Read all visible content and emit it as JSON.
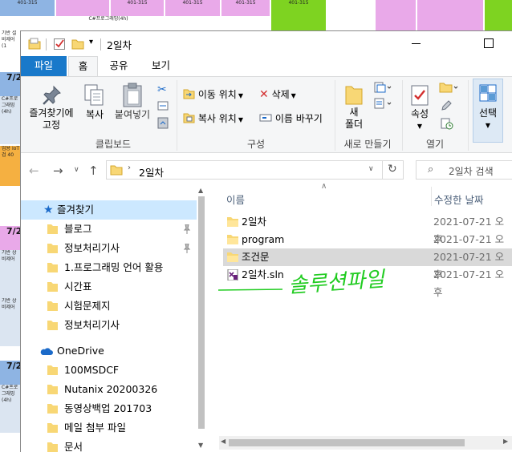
{
  "background": {
    "cells": [
      "401-315",
      "401-315",
      "401-315",
      "C#프로그래밍(4h)",
      "C#프로그래밍(4h)",
      "C#프로그래밍(4h)",
      "7/2",
      "7/2",
      "7/2",
      "7/2",
      "401-315",
      "401-315"
    ]
  },
  "window": {
    "title": "2일차",
    "tabs": {
      "file": "파일",
      "home": "홈",
      "share": "공유",
      "view": "보기"
    }
  },
  "ribbon": {
    "pin_label_1": "즐겨찾기에",
    "pin_label_2": "고정",
    "copy": "복사",
    "paste": "붙여넣기",
    "clipboard_group": "클립보드",
    "move_to": "이동 위치",
    "copy_to": "복사 위치",
    "delete": "삭제",
    "rename": "이름 바꾸기",
    "organize_group": "구성",
    "new_folder_1": "새",
    "new_folder_2": "폴더",
    "new_group": "새로 만들기",
    "properties": "속성",
    "open_group": "열기",
    "select": "선택"
  },
  "address": {
    "path": "2일차",
    "search_placeholder": "2일차 검색"
  },
  "nav_pane": {
    "favorites": "즐겨찾기",
    "items": [
      "블로그",
      "정보처리기사",
      "1.프로그래밍 언어 활용",
      "시간표",
      "시험문제지",
      "정보처리기사"
    ],
    "onedrive": "OneDrive",
    "onedrive_items": [
      "100MSDCF",
      "Nutanix 20200326",
      "동영상백업 201703",
      "메일 첨부 파일",
      "문서"
    ]
  },
  "file_list": {
    "col_name": "이름",
    "col_modified": "수정한 날짜",
    "rows": [
      {
        "name": "2일차",
        "modified": "2021-07-21 오후",
        "type": "folder"
      },
      {
        "name": "program",
        "modified": "2021-07-21 오후",
        "type": "folder"
      },
      {
        "name": "조건문",
        "modified": "2021-07-21 오후",
        "type": "folder",
        "selected": true
      },
      {
        "name": "2일차.sln",
        "modified": "2021-07-21 오후",
        "type": "solution"
      }
    ]
  },
  "annotation": {
    "handwriting": "솔루션파일",
    "color": "#22cc22"
  },
  "colors": {
    "file_tab": "#1979ca",
    "selection": "#cce8ff",
    "folder": "#f8d775",
    "bg_pink": "#e9a9e9",
    "bg_green": "#7ed321",
    "bg_blue": "#8eb4e3",
    "bg_orange": "#f5b041"
  }
}
